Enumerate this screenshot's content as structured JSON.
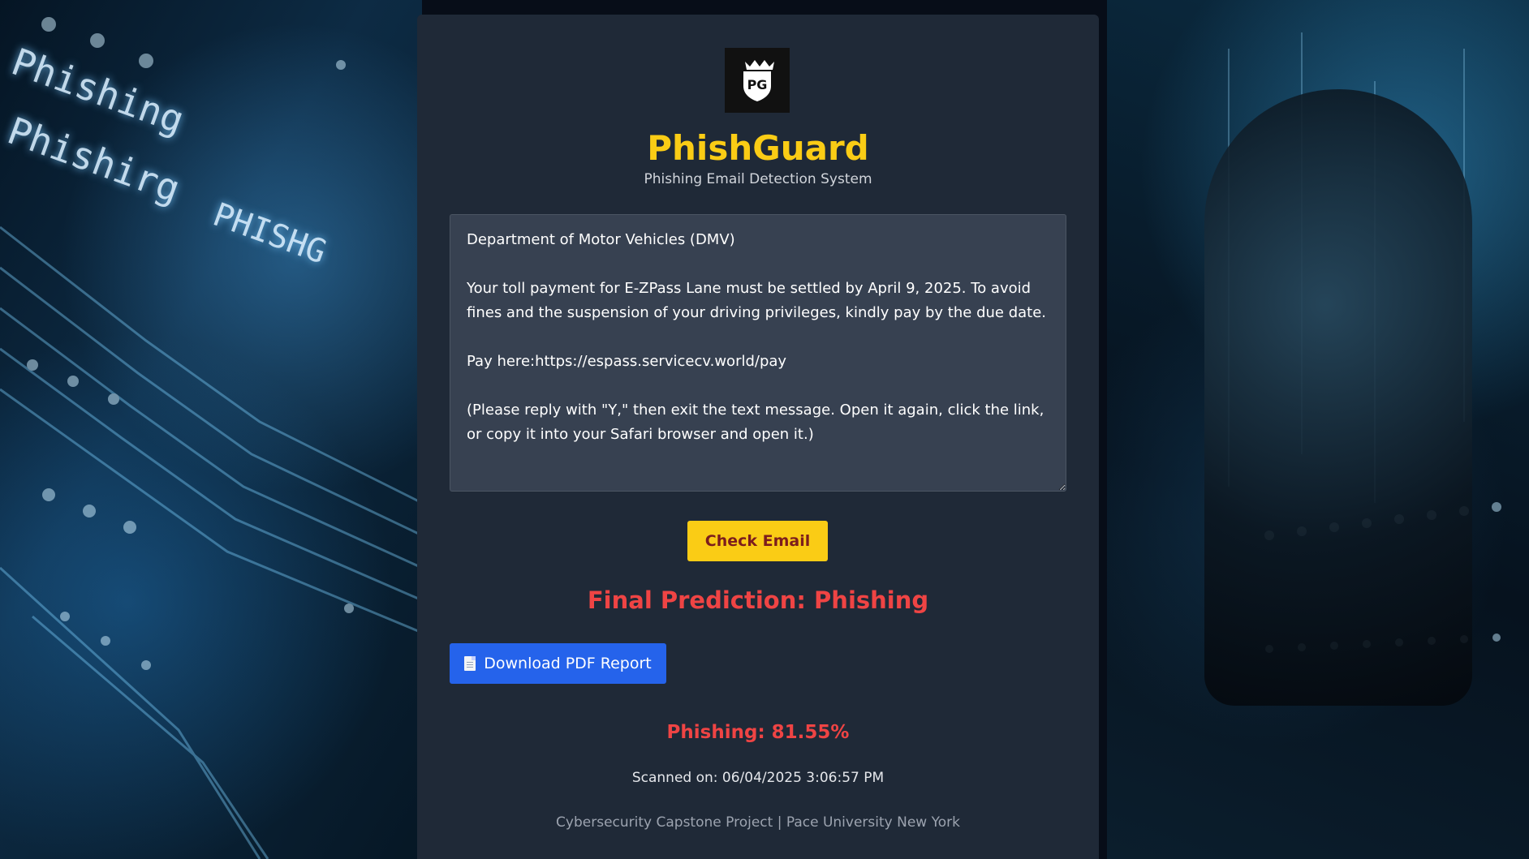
{
  "app": {
    "title": "PhishGuard",
    "subtitle": "Phishing Email Detection System"
  },
  "logo": {
    "icon": "shield-crown-logo"
  },
  "email": {
    "content": "Department of Motor Vehicles (DMV)\n\nYour toll payment for E-ZPass Lane must be settled by April 9, 2025. To avoid fines and the suspension of your driving privileges, kindly pay by the due date.\n\nPay here:https://espass.servicecv.world/pay\n\n(Please reply with \"Y,\" then exit the text message. Open it again, click the link, or copy it into your Safari browser and open it.)"
  },
  "actions": {
    "check_label": "Check Email",
    "download_label": "Download PDF Report",
    "download_icon": "document-icon"
  },
  "result": {
    "prediction": "Final Prediction: Phishing",
    "score": "Phishing: 81.55%",
    "scanned": "Scanned on: 06/04/2025 3:06:57 PM"
  },
  "footer": {
    "text": "Cybersecurity Capstone Project | Pace University New York"
  },
  "background": {
    "left_words": [
      "Phishing",
      "Phishirg",
      "PHISHG"
    ]
  },
  "colors": {
    "panel_bg": "#1f2937",
    "title": "#facc15",
    "danger": "#ef4444",
    "button_yellow": "#facc15",
    "button_blue": "#2563eb"
  }
}
